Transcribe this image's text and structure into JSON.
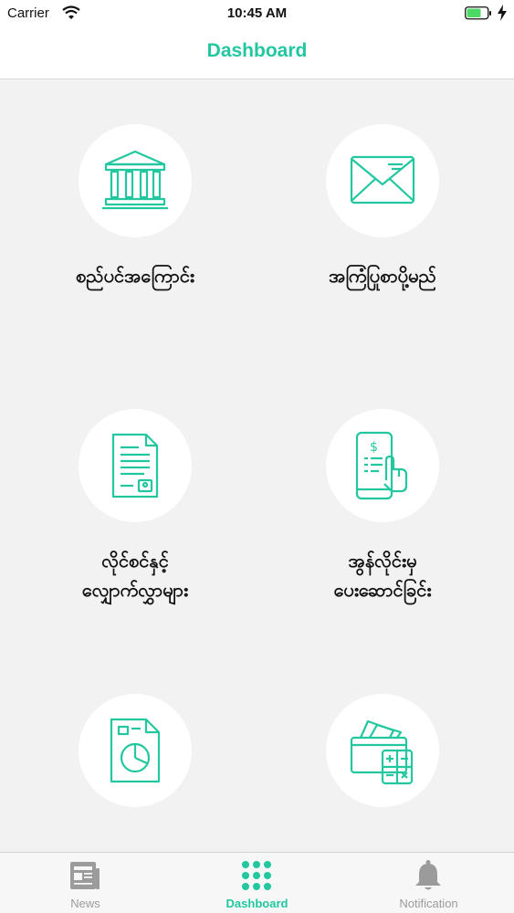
{
  "status_bar": {
    "carrier": "Carrier",
    "time": "10:45 AM"
  },
  "nav": {
    "title": "Dashboard"
  },
  "tiles": [
    {
      "label": "စည်ပင်အကြောင်း",
      "icon": "bank-building-icon"
    },
    {
      "label": "အကြံပြုစာပို့မည်",
      "icon": "envelope-icon"
    },
    {
      "label": "လိုင်စင်နှင့်\nလျှောက်လွှာများ",
      "icon": "license-document-icon"
    },
    {
      "label": "အွန်လိုင်းမှ\nပေးဆောင်ခြင်း",
      "icon": "mobile-payment-icon"
    },
    {
      "label": "",
      "icon": "report-chart-document-icon"
    },
    {
      "label": "",
      "icon": "wallet-calculator-icon"
    }
  ],
  "tab_bar": {
    "items": [
      {
        "label": "News",
        "icon": "newspaper-icon",
        "active": false
      },
      {
        "label": "Dashboard",
        "icon": "grid-dots-icon",
        "active": true
      },
      {
        "label": "Notification",
        "icon": "bell-icon",
        "active": false
      }
    ]
  },
  "colors": {
    "accent": "#22c7a0",
    "background": "#f2f2f2",
    "tab_inactive": "#9b9b9b"
  }
}
